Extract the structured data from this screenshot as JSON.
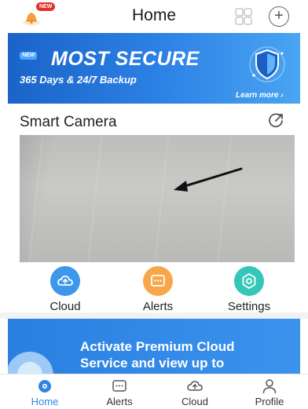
{
  "header": {
    "title": "Home",
    "new_badge": "NEW",
    "plus_symbol": "+",
    "icons": [
      "bell-icon",
      "grid-icon",
      "plus-icon"
    ]
  },
  "banner": {
    "new_tag": "NEW",
    "headline": "MOST SECURE",
    "subtitle": "365 Days & 24/7 Backup",
    "link": "Learn more ›",
    "icon": "shield-icon"
  },
  "camera": {
    "title": "Smart Camera",
    "share_icon": "share-icon"
  },
  "actions": [
    {
      "label": "Cloud",
      "icon": "cloud-icon",
      "color": "#3d97ea"
    },
    {
      "label": "Alerts",
      "icon": "alerts-icon",
      "color": "#f7a74a"
    },
    {
      "label": "Settings",
      "icon": "settings-icon",
      "color": "#34c6b8"
    }
  ],
  "promo": {
    "text_line1": "Activate Premium Cloud",
    "text_line2": "Service and view up to"
  },
  "bottom_nav": [
    {
      "label": "Home",
      "icon": "home-icon",
      "active": true
    },
    {
      "label": "Alerts",
      "icon": "alerts-icon",
      "active": false
    },
    {
      "label": "Cloud",
      "icon": "cloud-icon",
      "active": false
    },
    {
      "label": "Profile",
      "icon": "profile-icon",
      "active": false
    }
  ],
  "colors": {
    "accent": "#2f86e0",
    "banner_blue": "#2e83e6",
    "badge_red": "#e0322a"
  }
}
